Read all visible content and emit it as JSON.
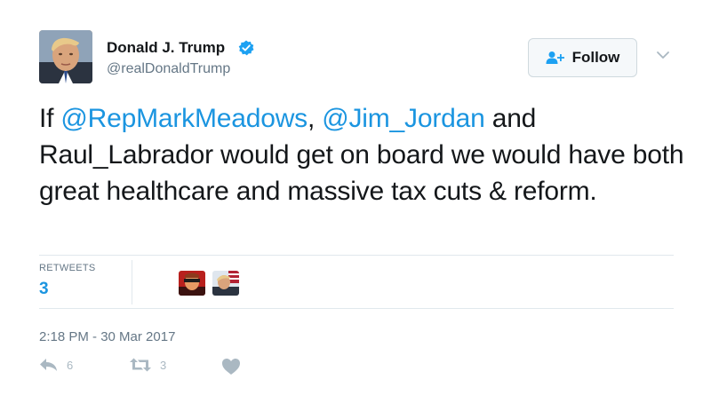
{
  "author": {
    "name": "Donald J. Trump",
    "handle": "@realDonaldTrump"
  },
  "follow_button": {
    "label": "Follow",
    "icon": "add-user-icon"
  },
  "menu_icon": "chevron-down-icon",
  "tweet": {
    "parts": [
      {
        "text": "If ",
        "mention": false
      },
      {
        "text": "@RepMarkMeadows",
        "mention": true
      },
      {
        "text": ", ",
        "mention": false
      },
      {
        "text": "@Jim_Jordan",
        "mention": true
      },
      {
        "text": " and Raul_Labrador would get on board we would have both great healthcare and massive tax cuts & reform.",
        "mention": false
      }
    ]
  },
  "stats": {
    "retweets_label": "RETWEETS",
    "retweets_count": "3"
  },
  "timestamp": "2:18 PM - 30 Mar 2017",
  "actions": {
    "reply_count": "6",
    "retweet_count": "3"
  },
  "colors": {
    "accent": "#1b95e0",
    "secondary_text": "#657786",
    "action_icon": "#aab8c2",
    "verified": "#1da1f2"
  }
}
